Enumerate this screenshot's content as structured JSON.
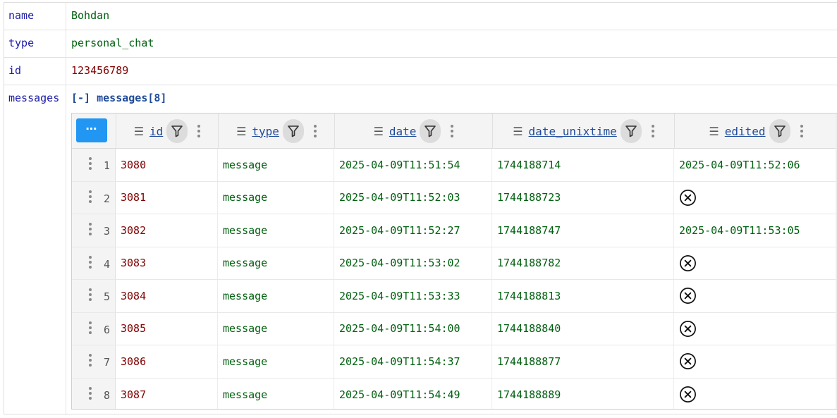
{
  "props": [
    {
      "key": "name",
      "value": "Bohdan",
      "kind": "str"
    },
    {
      "key": "type",
      "value": "personal_chat",
      "kind": "str"
    },
    {
      "key": "id",
      "value": "123456789",
      "kind": "num"
    }
  ],
  "messages": {
    "key": "messages",
    "header": "[-] messages[8]",
    "menu_label": "⋯",
    "columns": [
      {
        "id": "id",
        "label": "id"
      },
      {
        "id": "type",
        "label": "type"
      },
      {
        "id": "date",
        "label": "date"
      },
      {
        "id": "date_unixtime",
        "label": "date_unixtime"
      },
      {
        "id": "edited",
        "label": "edited"
      }
    ],
    "rows": [
      {
        "num": "1",
        "id": "3080",
        "type": "message",
        "date": "2025-04-09T11:51:54",
        "date_unixtime": "1744188714",
        "edited": "2025-04-09T11:52:06"
      },
      {
        "num": "2",
        "id": "3081",
        "type": "message",
        "date": "2025-04-09T11:52:03",
        "date_unixtime": "1744188723",
        "edited": null
      },
      {
        "num": "3",
        "id": "3082",
        "type": "message",
        "date": "2025-04-09T11:52:27",
        "date_unixtime": "1744188747",
        "edited": "2025-04-09T11:53:05"
      },
      {
        "num": "4",
        "id": "3083",
        "type": "message",
        "date": "2025-04-09T11:53:02",
        "date_unixtime": "1744188782",
        "edited": null
      },
      {
        "num": "5",
        "id": "3084",
        "type": "message",
        "date": "2025-04-09T11:53:33",
        "date_unixtime": "1744188813",
        "edited": null
      },
      {
        "num": "6",
        "id": "3085",
        "type": "message",
        "date": "2025-04-09T11:54:00",
        "date_unixtime": "1744188840",
        "edited": null
      },
      {
        "num": "7",
        "id": "3086",
        "type": "message",
        "date": "2025-04-09T11:54:37",
        "date_unixtime": "1744188877",
        "edited": null
      },
      {
        "num": "8",
        "id": "3087",
        "type": "message",
        "date": "2025-04-09T11:54:49",
        "date_unixtime": "1744188889",
        "edited": null
      }
    ]
  },
  "colors": {
    "key": "#1a1aa6",
    "string": "#00600f",
    "number": "#800000",
    "accent": "#2196f3",
    "column_title": "#1f4b99"
  },
  "icons": {
    "column_menu": "hamburger-icon",
    "filter": "filter-icon",
    "more": "vertical-dots-icon",
    "null_value": "circle-x-icon"
  }
}
